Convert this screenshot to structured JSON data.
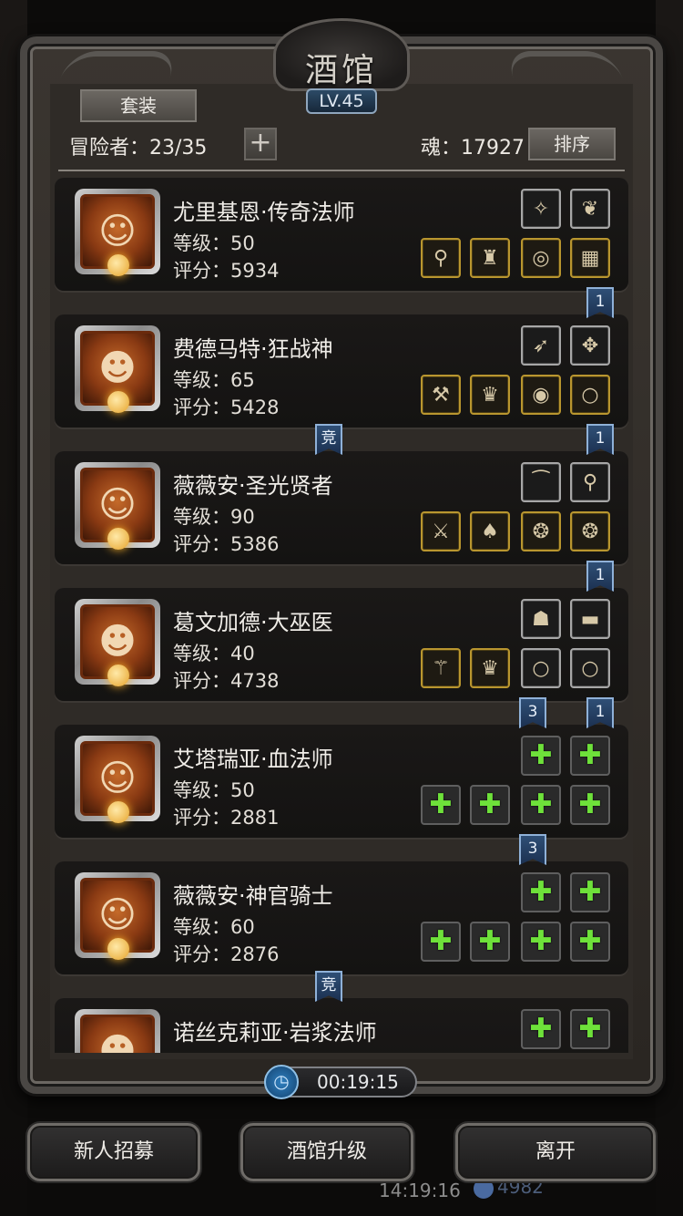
{
  "header": {
    "title": "酒馆",
    "level": "LV.45",
    "suit_tab": "套装",
    "adventurer_label": "冒险者：23/35",
    "soul_label": "魂：17927",
    "sort_button": "排序"
  },
  "heroes": [
    {
      "name": "尤里基恩·传奇法师",
      "level": "等级：50",
      "score": "评分：5934",
      "top_slots": [
        {
          "style": "silver",
          "icon": "✧"
        },
        {
          "style": "silver",
          "icon": "❦"
        }
      ],
      "bottom_slots": [
        {
          "style": "gold",
          "icon": "⚲"
        },
        {
          "style": "gold",
          "icon": "♜"
        },
        {
          "style": "gold",
          "icon": "◎"
        },
        {
          "style": "gold",
          "icon": "▦"
        }
      ]
    },
    {
      "name": "费德马特·狂战神",
      "level": "等级：65",
      "score": "评分：5428",
      "top_slots": [
        {
          "style": "silver",
          "icon": "➶"
        },
        {
          "style": "silver",
          "icon": "✥"
        }
      ],
      "bottom_slots": [
        {
          "style": "gold",
          "icon": "⚒"
        },
        {
          "style": "gold",
          "icon": "♛"
        },
        {
          "style": "gold",
          "icon": "◉"
        },
        {
          "style": "gold",
          "icon": "○"
        }
      ]
    },
    {
      "name": "薇薇安·圣光贤者",
      "level": "等级：90",
      "score": "评分：5386",
      "top_slots": [
        {
          "style": "silver",
          "icon": "⁀"
        },
        {
          "style": "silver",
          "icon": "⚲"
        }
      ],
      "bottom_slots": [
        {
          "style": "gold",
          "icon": "⚔"
        },
        {
          "style": "gold",
          "icon": "♠"
        },
        {
          "style": "gold",
          "icon": "❂"
        },
        {
          "style": "gold",
          "icon": "❂"
        }
      ]
    },
    {
      "name": "葛文加德·大巫医",
      "level": "等级：40",
      "score": "评分：4738",
      "top_slots": [
        {
          "style": "silver",
          "icon": "☗"
        },
        {
          "style": "silver",
          "icon": "▬"
        }
      ],
      "bottom_slots": [
        {
          "style": "gold",
          "icon": "⚚"
        },
        {
          "style": "gold",
          "icon": "♛"
        },
        {
          "style": "silver",
          "icon": "○"
        },
        {
          "style": "silver",
          "icon": "○"
        }
      ]
    },
    {
      "name": "艾塔瑞亚·血法师",
      "level": "等级：50",
      "score": "评分：2881",
      "top_slots": [
        {
          "style": "empty",
          "icon": "+"
        },
        {
          "style": "empty",
          "icon": "+"
        }
      ],
      "bottom_slots": [
        {
          "style": "empty",
          "icon": "+"
        },
        {
          "style": "empty",
          "icon": "+"
        },
        {
          "style": "empty",
          "icon": "+"
        },
        {
          "style": "empty",
          "icon": "+"
        }
      ]
    },
    {
      "name": "薇薇安·神官骑士",
      "level": "等级：60",
      "score": "评分：2876",
      "top_slots": [
        {
          "style": "empty",
          "icon": "+"
        },
        {
          "style": "empty",
          "icon": "+"
        }
      ],
      "bottom_slots": [
        {
          "style": "empty",
          "icon": "+"
        },
        {
          "style": "empty",
          "icon": "+"
        },
        {
          "style": "empty",
          "icon": "+"
        },
        {
          "style": "empty",
          "icon": "+"
        }
      ]
    },
    {
      "name": "诺丝克莉亚·岩浆法师",
      "level": "",
      "score": "",
      "top_slots": [
        {
          "style": "empty",
          "icon": "+"
        },
        {
          "style": "empty",
          "icon": "+"
        }
      ],
      "bottom_slots": []
    }
  ],
  "ribbons": [
    {
      "text": "1"
    },
    {
      "text": "竞"
    },
    {
      "text": "1"
    },
    {
      "text": "1"
    },
    {
      "text": "3"
    },
    {
      "text": "1"
    },
    {
      "text": "3"
    },
    {
      "text": "竞"
    }
  ],
  "timer": "00:19:15",
  "buttons": {
    "recruit": "新人招募",
    "upgrade": "酒馆升级",
    "leave": "离开"
  },
  "background": {
    "time": "14:19:16",
    "coins": "4982"
  },
  "colors": {
    "ribbon": "#2f4f76",
    "gold_slot": "#b9962f",
    "plus": "#6ee13a"
  }
}
